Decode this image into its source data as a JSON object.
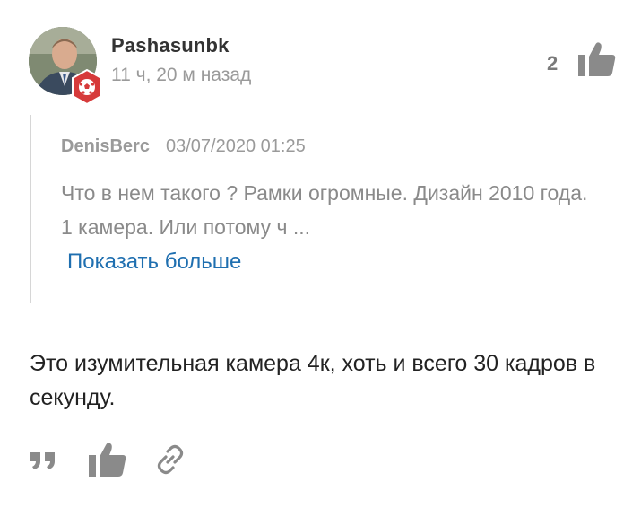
{
  "comment": {
    "username": "Pashasunbk",
    "timestamp": "11 ч, 20 м назад",
    "likes": "2",
    "quote": {
      "author": "DenisBerc",
      "date": "03/07/2020 01:25",
      "text": "Что в нем такого ? Рамки огромные. Дизайн 2010 года. 1 камера. Или потому ч ...",
      "show_more_label": "Показать больше"
    },
    "body": "Это изумительная камера 4к, хоть и всего 30 кадров в секунду."
  },
  "colors": {
    "link": "#1f6fb0",
    "badge": "#d63a3a",
    "icon": "#8a8a8a"
  },
  "icons": {
    "badge": "soccer-ball-hexagon",
    "like": "thumbs-up",
    "reply": "quote-marks",
    "share": "link"
  }
}
